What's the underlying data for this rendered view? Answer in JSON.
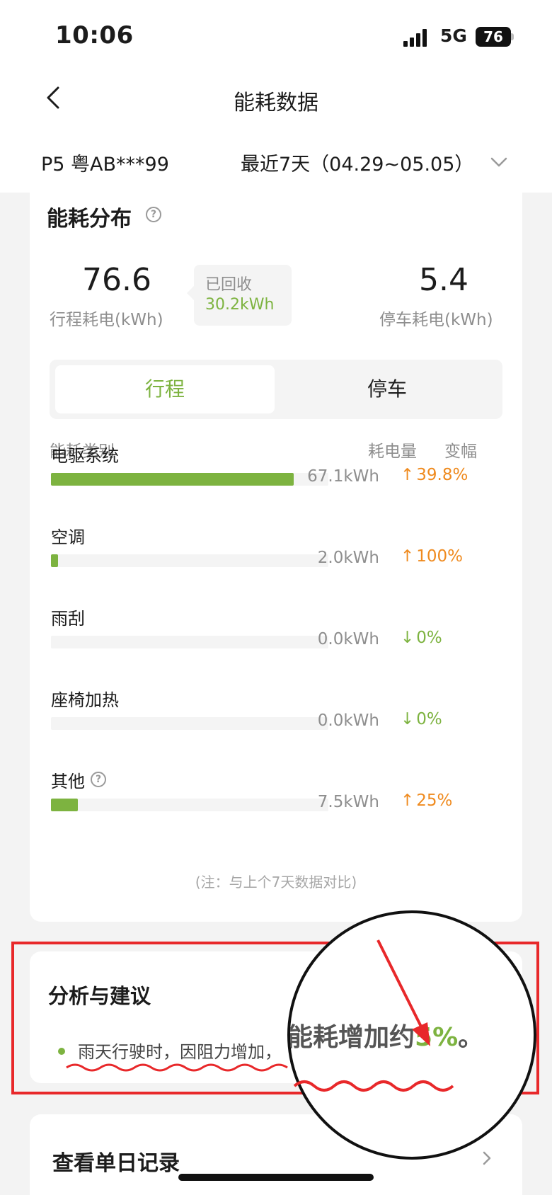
{
  "status_bar": {
    "time": "10:06",
    "network": "5G",
    "battery": "76"
  },
  "nav": {
    "title": "能耗数据"
  },
  "vehicle": {
    "name": "P5 粤AB***99",
    "period": "最近7天（04.29~05.05）"
  },
  "distribution": {
    "title": "能耗分布",
    "trip": {
      "value": "76.6",
      "label": "行程耗电(kWh)"
    },
    "recovered": {
      "label": "已回收",
      "value": "30.2kWh"
    },
    "parking": {
      "value": "5.4",
      "label": "停车耗电(kWh)"
    },
    "tabs": {
      "active": "行程",
      "inactive": "停车"
    },
    "headers": {
      "category": "能耗类别",
      "amount": "耗电量",
      "change": "变幅"
    },
    "rows": [
      {
        "name": "电驱系统",
        "amount": "67.1kWh",
        "change": "39.8%",
        "direction": "up",
        "share": 0.875
      },
      {
        "name": "空调",
        "amount": "2.0kWh",
        "change": "100%",
        "direction": "up",
        "share": 0.026
      },
      {
        "name": "雨刮",
        "amount": "0.0kWh",
        "change": "0%",
        "direction": "down",
        "share": 0
      },
      {
        "name": "座椅加热",
        "amount": "0.0kWh",
        "change": "0%",
        "direction": "down",
        "share": 0
      },
      {
        "name": "其他",
        "amount": "7.5kWh",
        "change": "25%",
        "direction": "up",
        "share": 0.098
      }
    ],
    "note": "(注：与上个7天数据对比)"
  },
  "analysis": {
    "title": "分析与建议",
    "advice": "雨天行驶时，因阻力增加，",
    "magnified_prefix": "能耗增加约",
    "magnified_value": "5%",
    "magnified_suffix": "。"
  },
  "daily": {
    "label": "查看单日记录"
  },
  "colors": {
    "accent_green": "#7db340",
    "increase_orange": "#ef8a1e",
    "annotation_red": "#e8282a"
  }
}
